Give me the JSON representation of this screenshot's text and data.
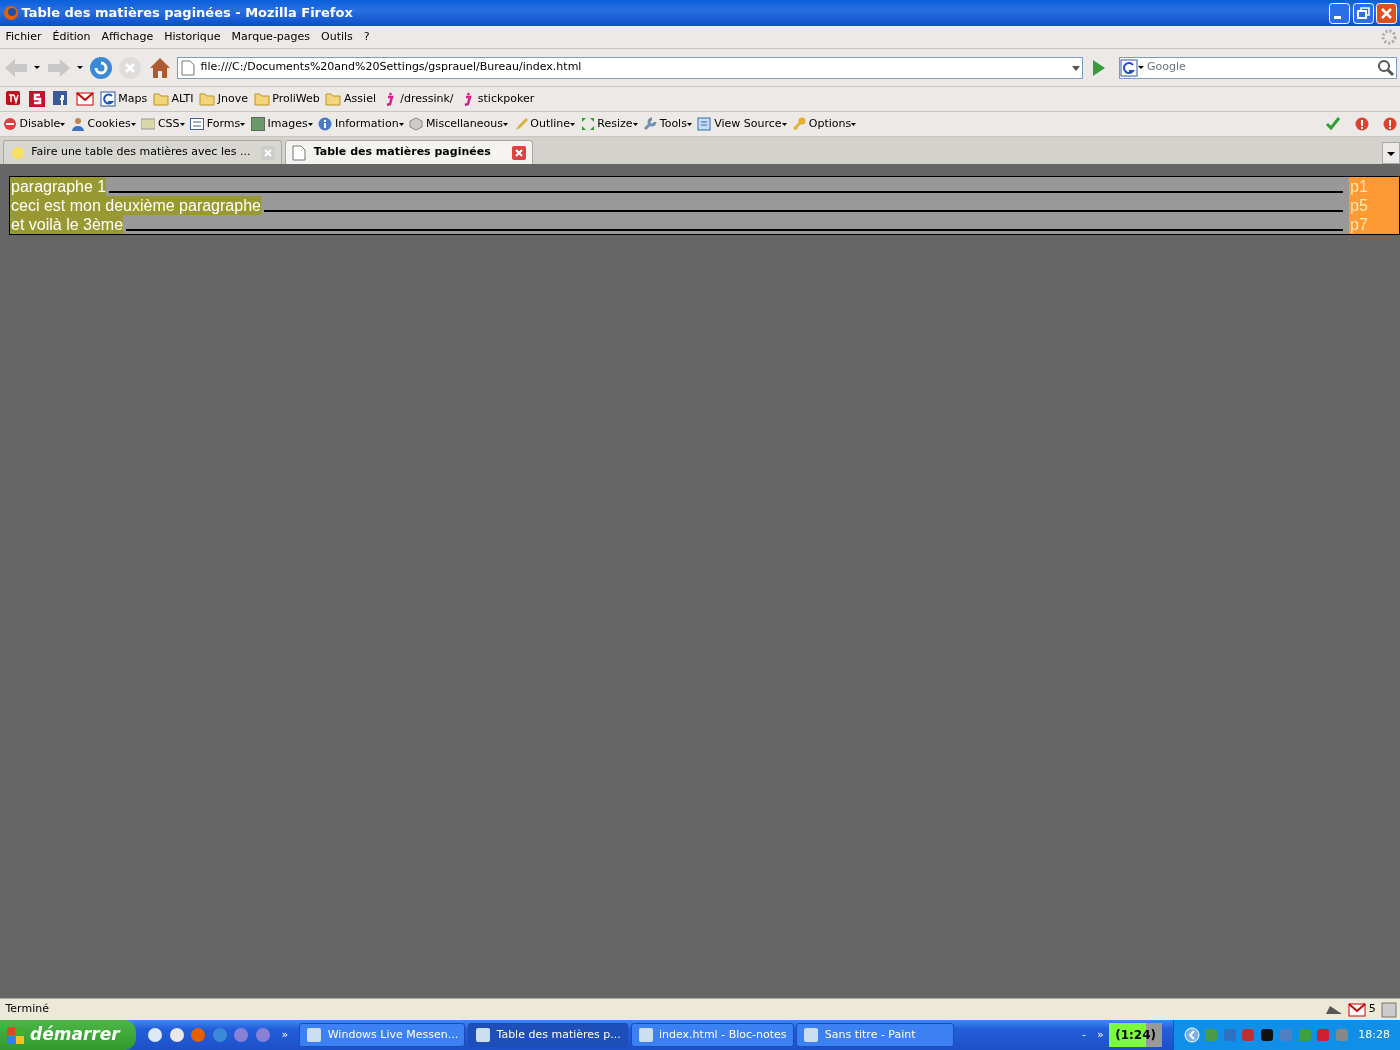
{
  "window": {
    "title": "Table des matières paginées - Mozilla Firefox"
  },
  "menu": [
    "Fichier",
    "Édition",
    "Affichage",
    "Historique",
    "Marque-pages",
    "Outils",
    "?"
  ],
  "nav": {
    "url": "file:///C:/Documents%20and%20Settings/gsprauel/Bureau/index.html",
    "search_placeholder": "Google"
  },
  "bookmarks": [
    {
      "kind": "tv"
    },
    {
      "kind": "s"
    },
    {
      "kind": "facebook"
    },
    {
      "kind": "gmail"
    },
    {
      "kind": "google",
      "label": "Maps"
    },
    {
      "kind": "folder",
      "label": "ALTI"
    },
    {
      "kind": "folder",
      "label": "Jnove"
    },
    {
      "kind": "folder",
      "label": "ProliWeb"
    },
    {
      "kind": "folder",
      "label": "Assiel"
    },
    {
      "kind": "j",
      "label": "/dressink/"
    },
    {
      "kind": "j",
      "label": "stickpoker"
    }
  ],
  "devtools": [
    {
      "kind": "disable",
      "label": "Disable"
    },
    {
      "kind": "cookies",
      "label": "Cookies"
    },
    {
      "kind": "css",
      "label": "CSS"
    },
    {
      "kind": "forms",
      "label": "Forms"
    },
    {
      "kind": "images",
      "label": "Images"
    },
    {
      "kind": "info",
      "label": "Information"
    },
    {
      "kind": "misc",
      "label": "Miscellaneous"
    },
    {
      "kind": "outline",
      "label": "Outline"
    },
    {
      "kind": "resize",
      "label": "Resize"
    },
    {
      "kind": "tools",
      "label": "Tools"
    },
    {
      "kind": "source",
      "label": "View Source"
    },
    {
      "kind": "options",
      "label": "Options"
    }
  ],
  "tabs": [
    {
      "label": "Faire une table des matières avec les ...",
      "selected": false
    },
    {
      "label": "Table des matières paginées",
      "selected": true
    }
  ],
  "toc": [
    {
      "title": "paragraphe 1",
      "page": "p1"
    },
    {
      "title": "ceci est mon deuxième paragraphe",
      "page": "p5"
    },
    {
      "title": "et voilà le 3ème",
      "page": "p7"
    }
  ],
  "status": {
    "text": "Terminé",
    "mail_count": "5"
  },
  "taskbar": {
    "start": "démarrer",
    "chevron": "»",
    "tasks": [
      {
        "label": "Windows Live Messen...",
        "selected": false
      },
      {
        "label": "Table des matières p...",
        "selected": true
      },
      {
        "label": "index.html - Bloc-notes",
        "selected": false
      },
      {
        "label": "Sans titre - Paint",
        "selected": false
      }
    ],
    "minus": "-",
    "tray_chevron": "»",
    "timer": "(1:24)",
    "clock": "18:28"
  }
}
